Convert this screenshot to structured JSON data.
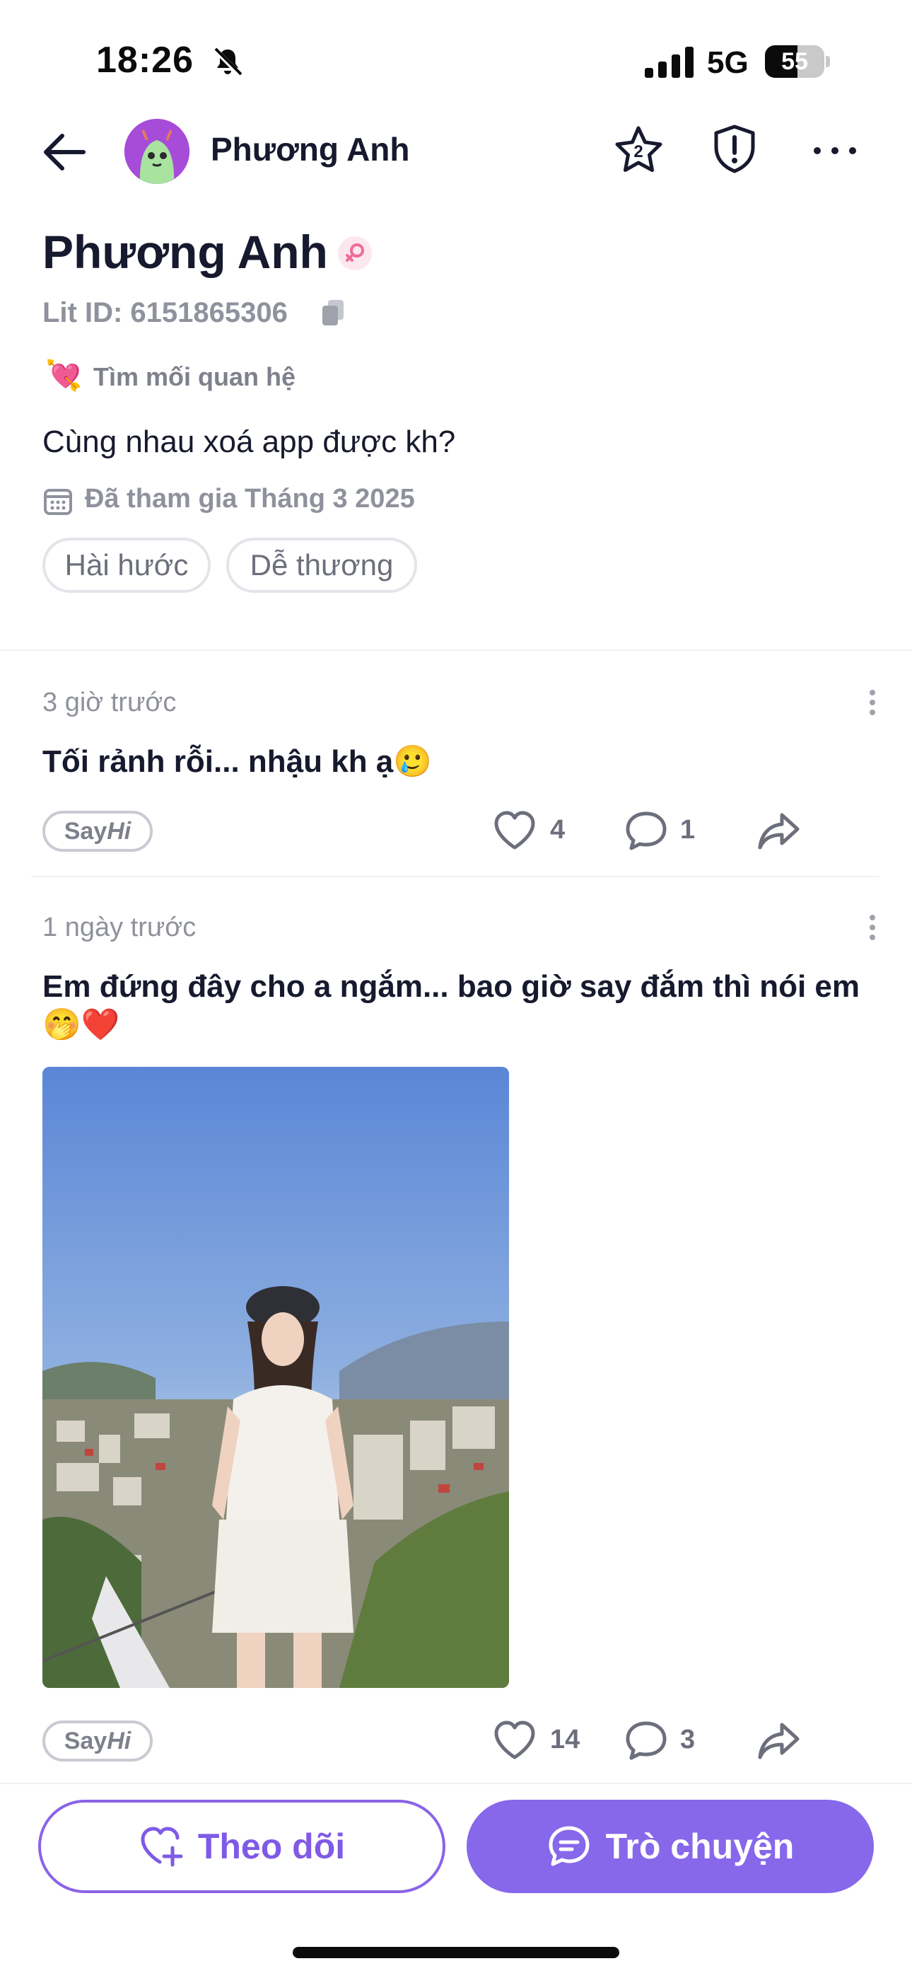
{
  "status_bar": {
    "time": "18:26",
    "network": "5G",
    "battery_percent": "55",
    "battery_level": 0.55
  },
  "header": {
    "name": "Phương Anh",
    "star_badge": "2"
  },
  "profile": {
    "name": "Phương Anh",
    "lit_id": "Lit ID: 6151865306",
    "intent_emoji": "💘",
    "intent": "Tìm mối quan hệ",
    "bio": "Cùng nhau xoá app được kh?",
    "joined": "Đã tham gia Tháng 3 2025",
    "tags": [
      "Hài hước",
      "Dễ thương"
    ]
  },
  "posts": [
    {
      "time": "3 giờ trước",
      "text": "Tối rảnh rỗi... nhậu kh ạ🥲",
      "sayhi_say": "Say",
      "sayhi_hi": "Hi",
      "likes": "4",
      "comments": "1"
    },
    {
      "time": "1 ngày trước",
      "text": "Em đứng đây cho a ngắm... bao giờ say đắm thì nói em🤭❤️",
      "sayhi_say": "Say",
      "sayhi_hi": "Hi",
      "likes": "14",
      "comments": "3"
    }
  ],
  "actions": {
    "follow_label": "Theo dõi",
    "chat_label": "Trò chuyện"
  },
  "colors": {
    "accent": "#8767ea",
    "text_primary": "#171a2e",
    "text_secondary": "#8f929c"
  },
  "icons": [
    "bell-muted-icon",
    "signal-icon",
    "back-arrow-icon",
    "star-icon",
    "shield-icon",
    "more-icon",
    "female-icon",
    "copy-icon",
    "calendar-icon",
    "heart-icon",
    "comment-icon",
    "share-icon",
    "heart-plus-icon",
    "chat-icon"
  ]
}
